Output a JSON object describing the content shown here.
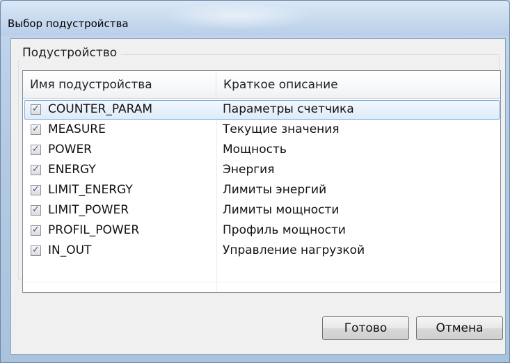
{
  "window": {
    "title": "Выбор подустройства"
  },
  "group": {
    "legend": "Подустройство"
  },
  "list": {
    "columns": [
      "Имя подустройства",
      "Краткое описание"
    ],
    "rows": [
      {
        "name": "COUNTER_PARAM",
        "description": "Параметры счетчика",
        "checked": true,
        "selected": true
      },
      {
        "name": "MEASURE",
        "description": "Текущие значения",
        "checked": true,
        "selected": false
      },
      {
        "name": "POWER",
        "description": "Мощность",
        "checked": true,
        "selected": false
      },
      {
        "name": "ENERGY",
        "description": "Энергия",
        "checked": true,
        "selected": false
      },
      {
        "name": "LIMIT_ENERGY",
        "description": "Лимиты энергий",
        "checked": true,
        "selected": false
      },
      {
        "name": "LIMIT_POWER",
        "description": "Лимиты мощности",
        "checked": true,
        "selected": false
      },
      {
        "name": "PROFIL_POWER",
        "description": "Профиль мощности",
        "checked": true,
        "selected": false
      },
      {
        "name": "IN_OUT",
        "description": "Управление нагрузкой",
        "checked": true,
        "selected": false
      }
    ]
  },
  "buttons": {
    "ok_label": "Готово",
    "cancel_label": "Отмена"
  },
  "icons": {
    "checkbox_checked": "checkbox-checked-icon"
  },
  "colors": {
    "selection_border": "#84acdd",
    "checkmark": "#3a5a8c"
  }
}
